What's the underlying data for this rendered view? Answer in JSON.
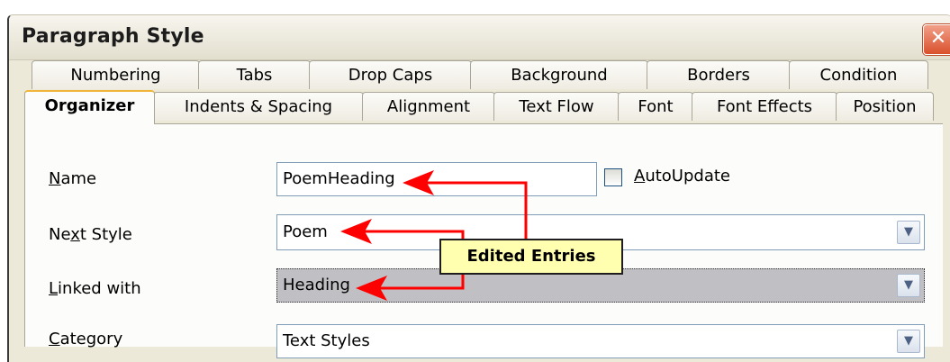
{
  "window": {
    "title": "Paragraph Style",
    "close_glyph": "✕"
  },
  "tabs_row1": [
    "Numbering",
    "Tabs",
    "Drop Caps",
    "Background",
    "Borders",
    "Condition"
  ],
  "tabs_row2": [
    "Organizer",
    "Indents & Spacing",
    "Alignment",
    "Text Flow",
    "Font",
    "Font Effects",
    "Position"
  ],
  "active_tab": "Organizer",
  "form": {
    "name_label_pre": "",
    "name_label_key": "N",
    "name_label_post": "ame",
    "name_value": "PoemHeading",
    "autoupdate_key": "A",
    "autoupdate_rest": "utoUpdate",
    "next_label_pre": "Ne",
    "next_label_key": "x",
    "next_label_post": "t Style",
    "next_value": "Poem",
    "linked_label_pre": "",
    "linked_label_key": "L",
    "linked_label_post": "inked with",
    "linked_value": "Heading",
    "category_label_pre": "",
    "category_label_key": "C",
    "category_label_post": "ategory",
    "category_value": "Text Styles",
    "dropdown_glyph": "▼"
  },
  "annotation": {
    "text": "Edited Entries",
    "arrow_color": "#ff0000"
  },
  "colors": {
    "accent": "#f0b53a",
    "close": "#d9502c",
    "note": "#ffffaf"
  }
}
